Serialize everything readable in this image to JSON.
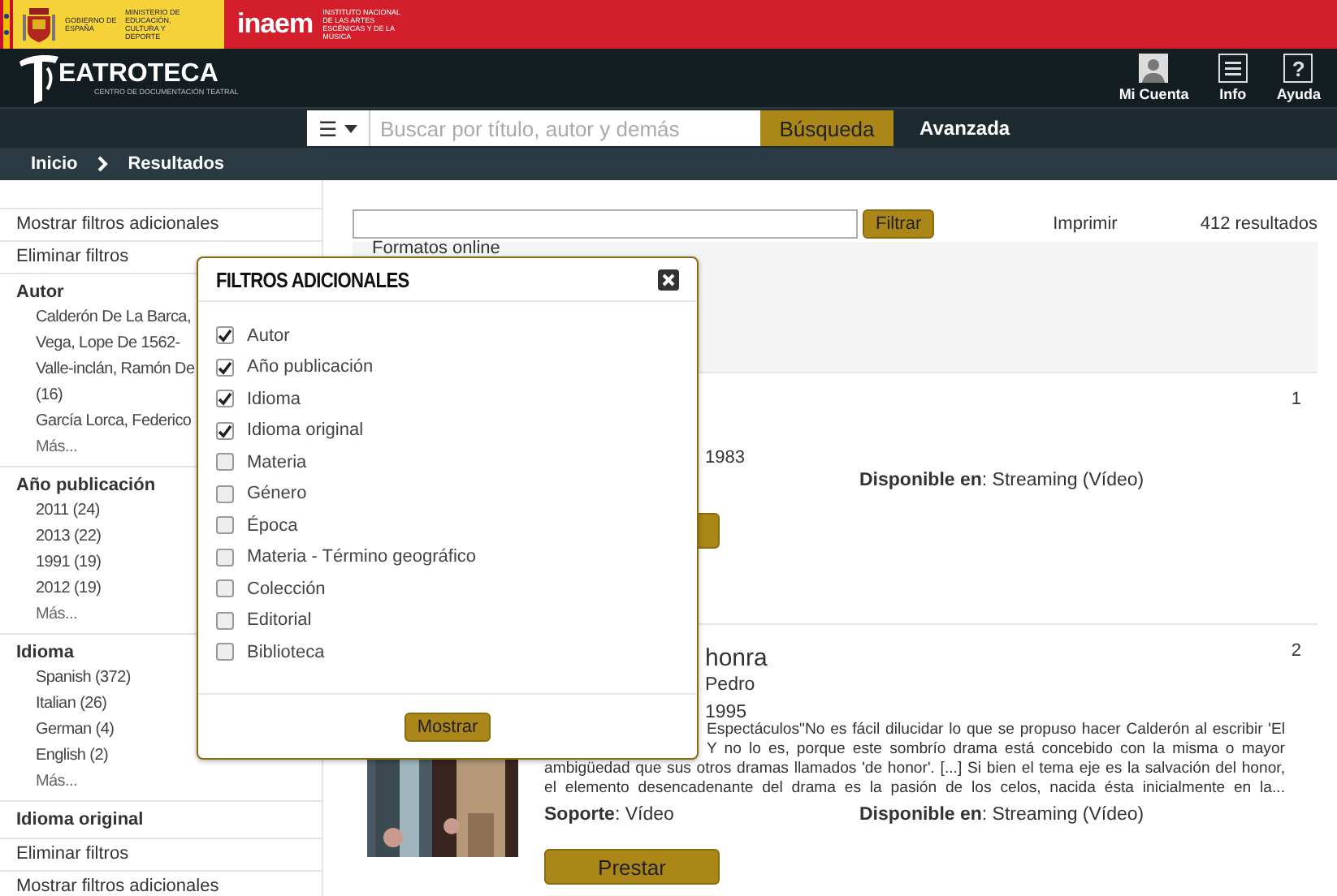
{
  "gov_banner": {
    "government": "GOBIERNO DE ESPAÑA",
    "ministry": "MINISTERIO DE EDUCACIÓN, CULTURA Y DEPORTE",
    "agency_logo": "inaem",
    "agency_name": "INSTITUTO NACIONAL DE LAS ARTES ESCÉNICAS Y DE LA MÚSICA"
  },
  "header": {
    "logo_text": "EATROTECA",
    "logo_subtitle": "CENTRO DE DOCUMENTACIÓN TEATRAL",
    "actions": [
      {
        "kind": "account",
        "label": "Mi Cuenta"
      },
      {
        "kind": "info",
        "label": "Info"
      },
      {
        "kind": "help",
        "label": "Ayuda",
        "glyph": "?"
      }
    ]
  },
  "search": {
    "menu_glyph": "☰",
    "placeholder": "Buscar por título, autor y demás",
    "button": "Búsqueda",
    "advanced": "Avanzada"
  },
  "breadcrumb": [
    "Inicio",
    "Resultados"
  ],
  "sidebar": {
    "top_links": [
      "Mostrar filtros adicionales",
      "Eliminar filtros"
    ],
    "facets": [
      {
        "title": "Autor",
        "items": [
          "Calderón De La Barca,",
          "Vega, Lope De 1562-",
          [
            "Valle-inclán, Ramón De",
            "(16)"
          ],
          "García Lorca, Federico"
        ],
        "more": "Más..."
      },
      {
        "title": "Año publicación",
        "items": [
          "2011 (24)",
          "2013 (22)",
          "1991 (19)",
          "2012 (19)"
        ],
        "more": "Más..."
      },
      {
        "title": "Idioma",
        "items": [
          "Spanish (372)",
          "Italian (26)",
          "German (4)",
          "English (2)"
        ],
        "more": "Más..."
      },
      {
        "title": "Idioma original"
      }
    ],
    "bottom_links": [
      "Eliminar filtros",
      "Mostrar filtros adicionales"
    ]
  },
  "results": {
    "filter_button": "Filtrar",
    "print": "Imprimir",
    "count": "412 resultados",
    "formats_heading": "Formatos online",
    "records": [
      {
        "number": "1",
        "year": "1983",
        "available": "**Disponible en**: Streaming (Vídeo)"
      },
      {
        "number": "2",
        "title": "honra",
        "author": "Pedro",
        "year": "1995",
        "description": [
          "Espectáculos\"No es fácil dilucidar lo que se propuso hacer Calderón al escribir 'El",
          "Y no lo es, porque este sombrío drama está concebido con la misma o mayor",
          "ambigüedad que sus otros dramas llamados 'de honor'. [...] Si bien el tema eje es la salvación del honor,",
          "el elemento desencadenante del drama es la pasión de los celos, nacida ésta inicialmente en la..."
        ],
        "support": "**Soporte**: Vídeo",
        "available": "**Disponible en**: Streaming (Vídeo)",
        "button": "Prestar",
        "kind": "picture"
      }
    ]
  },
  "modal": {
    "title": "FILTROS ADICIONALES",
    "options": [
      {
        "label": "Autor",
        "checked": true
      },
      {
        "label": "Año publicación",
        "checked": true
      },
      {
        "label": "Idioma",
        "checked": true
      },
      {
        "label": "Idioma original",
        "checked": true
      },
      {
        "label": "Materia",
        "checked": false
      },
      {
        "label": "Género",
        "checked": false
      },
      {
        "label": "Época",
        "checked": false
      },
      {
        "label": "Materia - Término geográfico",
        "checked": false
      },
      {
        "label": "Colección",
        "checked": false
      },
      {
        "label": "Editorial",
        "checked": false
      },
      {
        "label": "Biblioteca",
        "checked": false
      }
    ],
    "button": "Mostrar"
  }
}
